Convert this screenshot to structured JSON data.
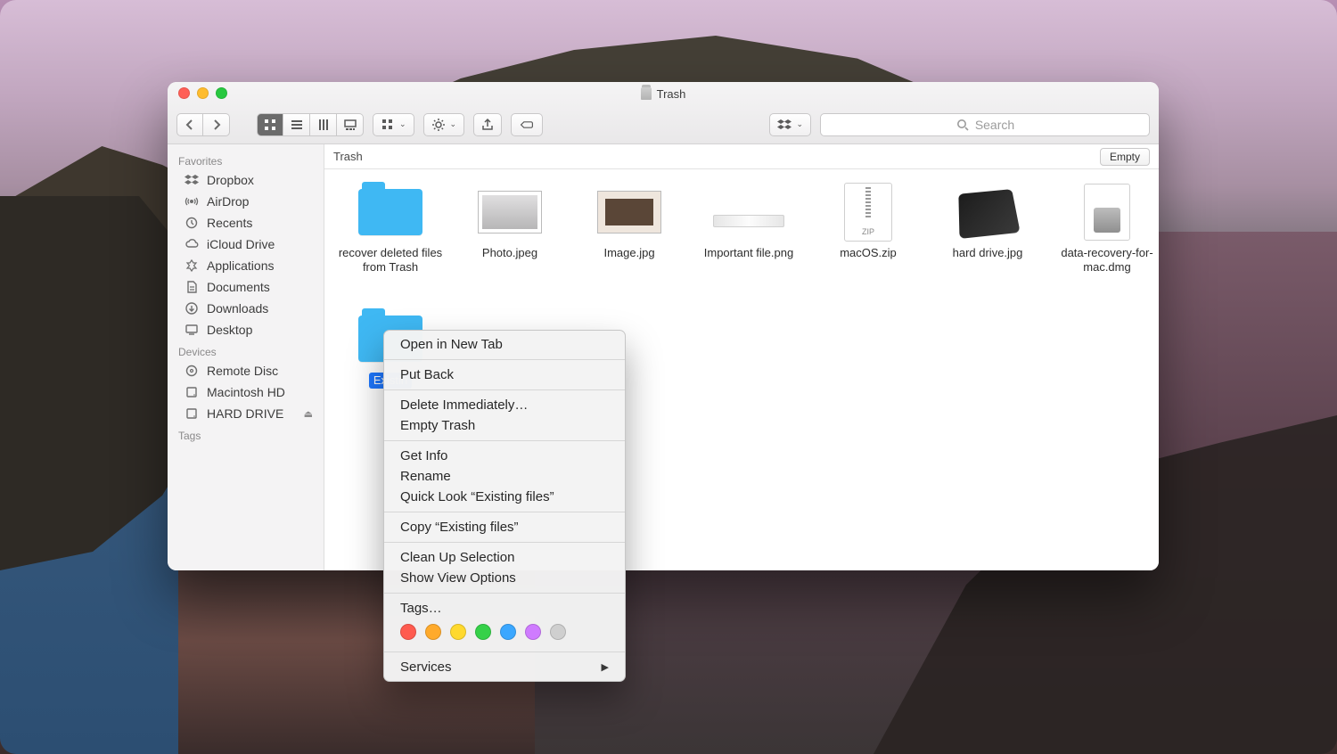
{
  "window": {
    "title": "Trash"
  },
  "toolbar": {
    "search_placeholder": "Search"
  },
  "location_bar": {
    "path_label": "Trash",
    "empty_button": "Empty"
  },
  "sidebar": {
    "sections": [
      {
        "header": "Favorites",
        "items": [
          {
            "icon": "dropbox",
            "label": "Dropbox"
          },
          {
            "icon": "airdrop",
            "label": "AirDrop"
          },
          {
            "icon": "recents",
            "label": "Recents"
          },
          {
            "icon": "icloud",
            "label": "iCloud Drive"
          },
          {
            "icon": "apps",
            "label": "Applications"
          },
          {
            "icon": "docs",
            "label": "Documents"
          },
          {
            "icon": "downloads",
            "label": "Downloads"
          },
          {
            "icon": "desktop",
            "label": "Desktop"
          }
        ]
      },
      {
        "header": "Devices",
        "items": [
          {
            "icon": "disc",
            "label": "Remote Disc"
          },
          {
            "icon": "hdd",
            "label": "Macintosh HD"
          },
          {
            "icon": "ext",
            "label": "HARD DRIVE",
            "eject": true
          }
        ]
      },
      {
        "header": "Tags",
        "items": []
      }
    ]
  },
  "files": [
    {
      "name": "recover deleted files from Trash",
      "kind": "folder"
    },
    {
      "name": "Photo.jpeg",
      "kind": "photo"
    },
    {
      "name": "Image.jpg",
      "kind": "image"
    },
    {
      "name": "Important file.png",
      "kind": "png"
    },
    {
      "name": "macOS.zip",
      "kind": "zip"
    },
    {
      "name": "hard drive.jpg",
      "kind": "hd"
    },
    {
      "name": "data-recovery-for-mac.dmg",
      "kind": "dmg"
    },
    {
      "name": "Existing files",
      "kind": "folder",
      "selected": true,
      "truncated_label": "Existin"
    }
  ],
  "context_menu": {
    "items": [
      {
        "type": "item",
        "label": "Open in New Tab"
      },
      {
        "type": "sep"
      },
      {
        "type": "item",
        "label": "Put Back"
      },
      {
        "type": "sep"
      },
      {
        "type": "item",
        "label": "Delete Immediately…"
      },
      {
        "type": "item",
        "label": "Empty Trash"
      },
      {
        "type": "sep"
      },
      {
        "type": "item",
        "label": "Get Info"
      },
      {
        "type": "item",
        "label": "Rename"
      },
      {
        "type": "item",
        "label": "Quick Look “Existing files”"
      },
      {
        "type": "sep"
      },
      {
        "type": "item",
        "label": "Copy “Existing files”"
      },
      {
        "type": "sep"
      },
      {
        "type": "item",
        "label": "Clean Up Selection"
      },
      {
        "type": "item",
        "label": "Show View Options"
      },
      {
        "type": "sep"
      },
      {
        "type": "item",
        "label": "Tags…"
      },
      {
        "type": "tags"
      },
      {
        "type": "sep"
      },
      {
        "type": "submenu",
        "label": "Services"
      }
    ],
    "tag_colors": [
      "t-red",
      "t-org",
      "t-yel",
      "t-grn",
      "t-blu",
      "t-pur",
      "t-gry"
    ]
  }
}
